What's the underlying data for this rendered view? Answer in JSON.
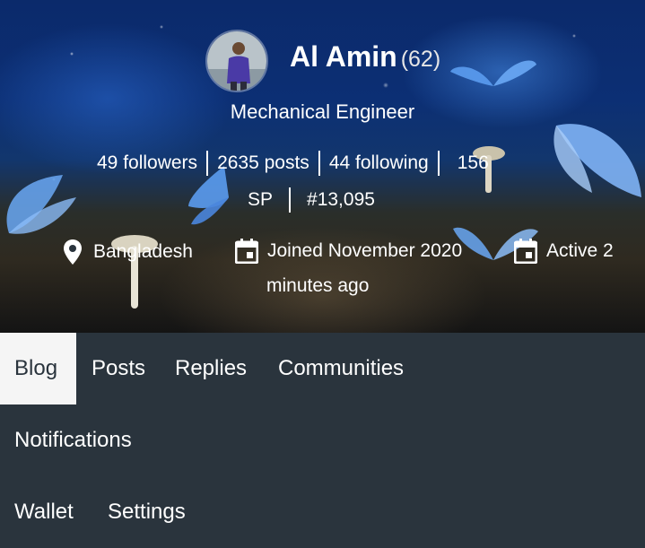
{
  "profile": {
    "name": "Al Amin",
    "reputation": "(62)",
    "title": "Mechanical Engineer"
  },
  "stats": {
    "followers": "49 followers",
    "posts": "2635 posts",
    "following": "44 following",
    "sp_number": "156",
    "sp_label": "SP",
    "rank": "#13,095"
  },
  "meta": {
    "location": "Bangladesh",
    "joined": "Joined November 2020",
    "active_line1": "Active 2",
    "active_line2": "minutes ago"
  },
  "tabs": [
    "Blog",
    "Posts",
    "Replies",
    "Communities",
    "Notifications",
    "Wallet",
    "Settings"
  ],
  "colors": {
    "nav_background": "#2a343d",
    "active_tab": "#f5f5f5",
    "text": "#ffffff"
  },
  "icons": {
    "location": "location-pin-icon",
    "joined": "calendar-icon",
    "active": "calendar-icon"
  }
}
